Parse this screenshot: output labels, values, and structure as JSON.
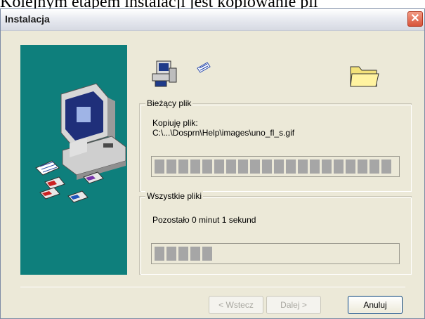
{
  "page_caption_top": "Kolejnym etapem instalacji jest kopiowanie pli",
  "window": {
    "title": "Instalacja",
    "close_symbol": "✕"
  },
  "current_file": {
    "legend": "Bieżący plik",
    "label": "Kopiuję plik:",
    "path": "C:\\...\\Dosprn\\Help\\images\\uno_fl_s.gif",
    "progress_fraction": 1.0
  },
  "all_files": {
    "legend": "Wszystkie pliki",
    "remaining": "Pozostało 0 minut 1 sekund",
    "progress_fraction": 0.24
  },
  "buttons": {
    "back": "< Wstecz",
    "next": "Dalej >",
    "cancel": "Anuluj"
  },
  "icons": [
    "computer-install-icon",
    "floppy-flying-icon",
    "folder-icon",
    "computer-illustration-icon"
  ],
  "colors": {
    "side_panel": "#0e7f7c",
    "progress_segment": "#a6a6a6",
    "close_button": "#d8533a"
  }
}
